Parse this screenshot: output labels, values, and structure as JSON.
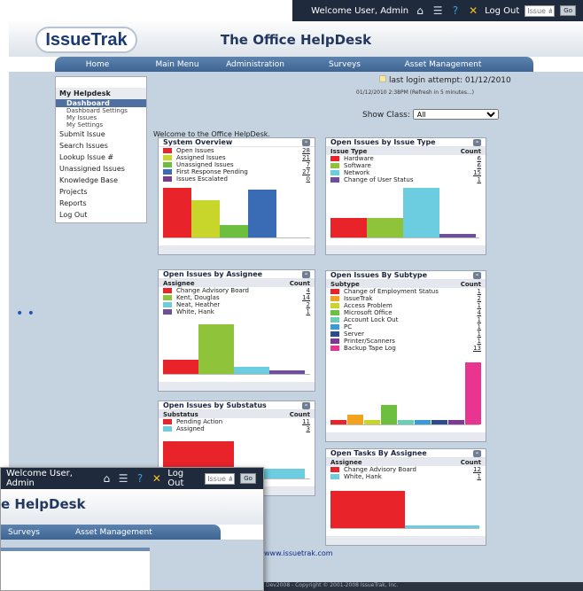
{
  "topbar": {
    "welcome": "Welcome User, Admin",
    "logout": "Log Out",
    "issue_placeholder": "Issue #",
    "go": "Go"
  },
  "header": {
    "logo_text": "IssueTrak",
    "title": "The Office HelpDesk"
  },
  "nav": [
    "Home",
    "Main Menu",
    "Administration",
    "Surveys",
    "Asset Management"
  ],
  "sidebar": {
    "section": "My Helpdesk",
    "subitems": [
      {
        "label": "Dashboard",
        "active": true
      },
      {
        "label": "Dashboard Settings",
        "active": false
      },
      {
        "label": "My Issues",
        "active": false
      },
      {
        "label": "My Settings",
        "active": false
      }
    ],
    "items": [
      "Submit Issue",
      "Search Issues",
      "Lookup Issue #",
      "Unassigned Issues",
      "Knowledge Base",
      "Projects",
      "Reports",
      "Log Out"
    ]
  },
  "status": {
    "last_login": "last login attempt: 01/12/2010",
    "refresh": "01/12/2010 2:38PM (Refresh in 5 minutes...)",
    "show_class_label": "Show Class:",
    "show_class_value": "All",
    "welcome": "Welcome to the Office HelpDesk."
  },
  "panels": {
    "overview": {
      "title": "System Overview",
      "rows": [
        {
          "label": "Open Issues",
          "count": "28",
          "color": "#e8232a"
        },
        {
          "label": "Assigned Issues",
          "count": "21",
          "color": "#c8d62b"
        },
        {
          "label": "Unassigned Issues",
          "count": "7",
          "color": "#6cbf3f"
        },
        {
          "label": "First Response Pending",
          "count": "27",
          "color": "#3a6cb5"
        },
        {
          "label": "Issues Escalated",
          "count": "0",
          "color": "#7d3a93"
        }
      ]
    },
    "by_type": {
      "title": "Open Issues by Issue Type",
      "col1": "Issue Type",
      "col2": "Count",
      "rows": [
        {
          "label": "Hardware",
          "count": "6",
          "color": "#e8232a"
        },
        {
          "label": "Software",
          "count": "6",
          "color": "#8fc43a"
        },
        {
          "label": "Network",
          "count": "15",
          "color": "#6ccde0"
        },
        {
          "label": "Change of User Status",
          "count": "1",
          "color": "#6f4e9b"
        }
      ]
    },
    "by_assignee": {
      "title": "Open Issues by Assignee",
      "col1": "Assignee",
      "col2": "Count",
      "rows": [
        {
          "label": "Change Advisory Board",
          "count": "4",
          "color": "#e8232a"
        },
        {
          "label": "Kent, Douglas",
          "count": "14",
          "color": "#8fc43a"
        },
        {
          "label": "Neat, Heather",
          "count": "2",
          "color": "#6ccde0"
        },
        {
          "label": "White, Hank",
          "count": "1",
          "color": "#6f4e9b"
        }
      ]
    },
    "by_subtype": {
      "title": "Open Issues By Subtype",
      "col1": "Subtype",
      "col2": "Count",
      "rows": [
        {
          "label": "Change of Employment Status",
          "count": "1",
          "color": "#e8232a"
        },
        {
          "label": "IssueTrak",
          "count": "2",
          "color": "#f2a21c"
        },
        {
          "label": "Access Problem",
          "count": "1",
          "color": "#c8d62b"
        },
        {
          "label": "Microsoft Office",
          "count": "4",
          "color": "#6cbf3f"
        },
        {
          "label": "Account Lock Out",
          "count": "1",
          "color": "#6ccdb8"
        },
        {
          "label": "PC",
          "count": "1",
          "color": "#3a9ad9"
        },
        {
          "label": "Server",
          "count": "1",
          "color": "#2c4a8c"
        },
        {
          "label": "Printer/Scanners",
          "count": "1",
          "color": "#7d3a93"
        },
        {
          "label": "Backup Tape Log",
          "count": "13",
          "color": "#e8358f"
        }
      ]
    },
    "by_substatus": {
      "title": "Open Issues by Substatus",
      "col1": "Substatus",
      "col2": "Count",
      "rows": [
        {
          "label": "Pending Action",
          "count": "11",
          "color": "#e8232a"
        },
        {
          "label": "Assigned",
          "count": "3",
          "color": "#6ccde0"
        }
      ]
    },
    "tasks": {
      "title": "Open Tasks By Assignee",
      "col1": "Assignee",
      "col2": "Count",
      "rows": [
        {
          "label": "Change Advisory Board",
          "count": "12",
          "color": "#e8232a"
        },
        {
          "label": "White, Hank",
          "count": "1",
          "color": "#6ccde0"
        }
      ]
    }
  },
  "overlay": {
    "welcome": "Welcome User, Admin",
    "logout": "Log Out",
    "issue_placeholder": "Issue #",
    "go": "Go",
    "title": "e HelpDesk",
    "nav": [
      "Surveys",
      "Asset Management"
    ]
  },
  "footer": {
    "link": "www.issuetrak.com",
    "copyright": "Dev2008 - Copyright © 2001-2008 IssueTrak, Inc."
  }
}
